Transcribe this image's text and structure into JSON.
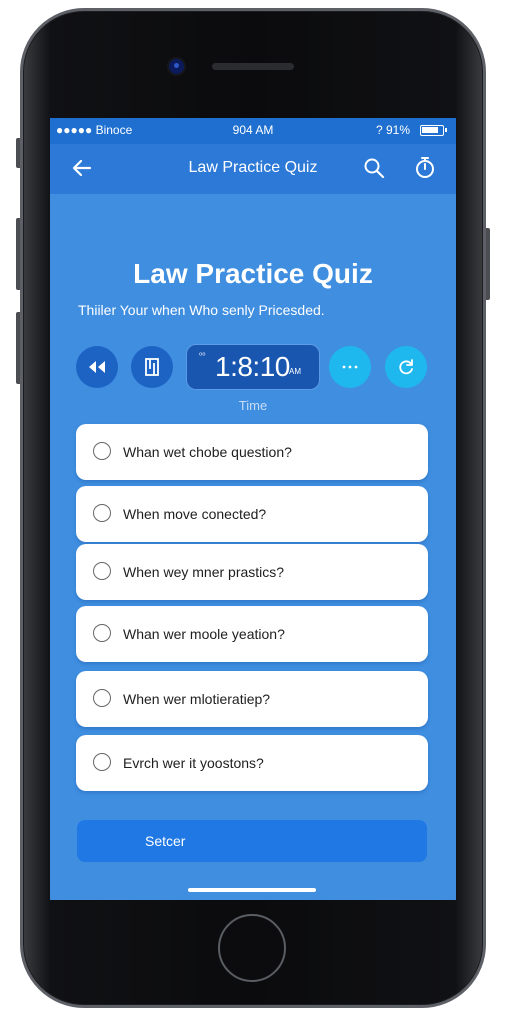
{
  "status_bar": {
    "carrier": "●●●●● Binoce",
    "time": "904 AM",
    "battery_text": "? 91%"
  },
  "app_bar": {
    "title": "Law Practice Quiz"
  },
  "heading": "Law Practice Quiz",
  "subheading": "Thiiler Your when Who senly Pricesded.",
  "timer": {
    "small_label": "⁰⁰",
    "value": "1:8:10",
    "ampm": "AM",
    "caption": "Time"
  },
  "answers": [
    {
      "label": "Whan wet chobe question?"
    },
    {
      "label": "When move conected?"
    },
    {
      "label": "When wey mner prastics?"
    },
    {
      "label": "Whan wer moole yeation?"
    },
    {
      "label": "When wer mlotieratiep?"
    },
    {
      "label": "Evrch wer it yoostons?"
    }
  ],
  "submit_label": "Setcer",
  "icons": {
    "back": "arrow-left-icon",
    "search": "search-icon",
    "timer": "stopwatch-icon",
    "rewind": "rewind-icon",
    "bookmark": "bookmark-icon",
    "more": "more-icon",
    "refresh": "refresh-icon"
  },
  "colors": {
    "screen_bg": "#3f8ee0",
    "status_bar": "#1f6fd0",
    "app_bar": "#2c79d8",
    "accent_cyan": "#1fb8ee",
    "button": "#1f78e3"
  }
}
